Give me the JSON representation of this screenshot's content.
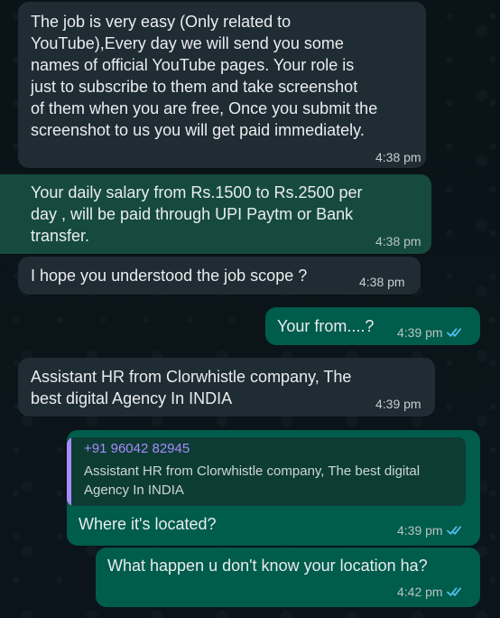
{
  "messages": [
    {
      "text": "The job  is very easy (Only related to\nYouTube),Every day we will send you some\nnames of official  YouTube pages. Your role is\njust to subscribe to them and take screenshot\nof them when you are free, Once you submit the\nscreenshot to us you will get paid immediately.",
      "time": "4:38 pm"
    },
    {
      "text": "Your daily salary from Rs.1500 to Rs.2500 per\nday , will be paid through UPI Paytm or Bank\ntransfer.",
      "time": "4:38 pm"
    },
    {
      "text": "I hope you understood the job scope ?",
      "time": "4:38 pm"
    },
    {
      "text": "Your from....?",
      "time": "4:39 pm"
    },
    {
      "text": "Assistant HR from Clorwhistle company, The\nbest digital Agency In INDIA",
      "time": "4:39 pm"
    },
    {
      "quote_name": "+91 96042 82945",
      "quote_text": "Assistant HR from Clorwhistle company, The best\ndigital Agency In INDIA",
      "text": "Where it's located?",
      "time": "4:39 pm"
    },
    {
      "text": "What happen u don't know your location ha?",
      "time": "4:42 pm"
    }
  ],
  "colors": {
    "background": "#0b141a",
    "incoming_bubble": "#202c33",
    "outgoing_bubble": "#005c4b",
    "highlighted_bubble": "#164a3f",
    "read_ticks": "#53bdeb",
    "quote_accent": "#a78bfa"
  },
  "icons": {
    "read_receipt": "double-check-icon"
  }
}
